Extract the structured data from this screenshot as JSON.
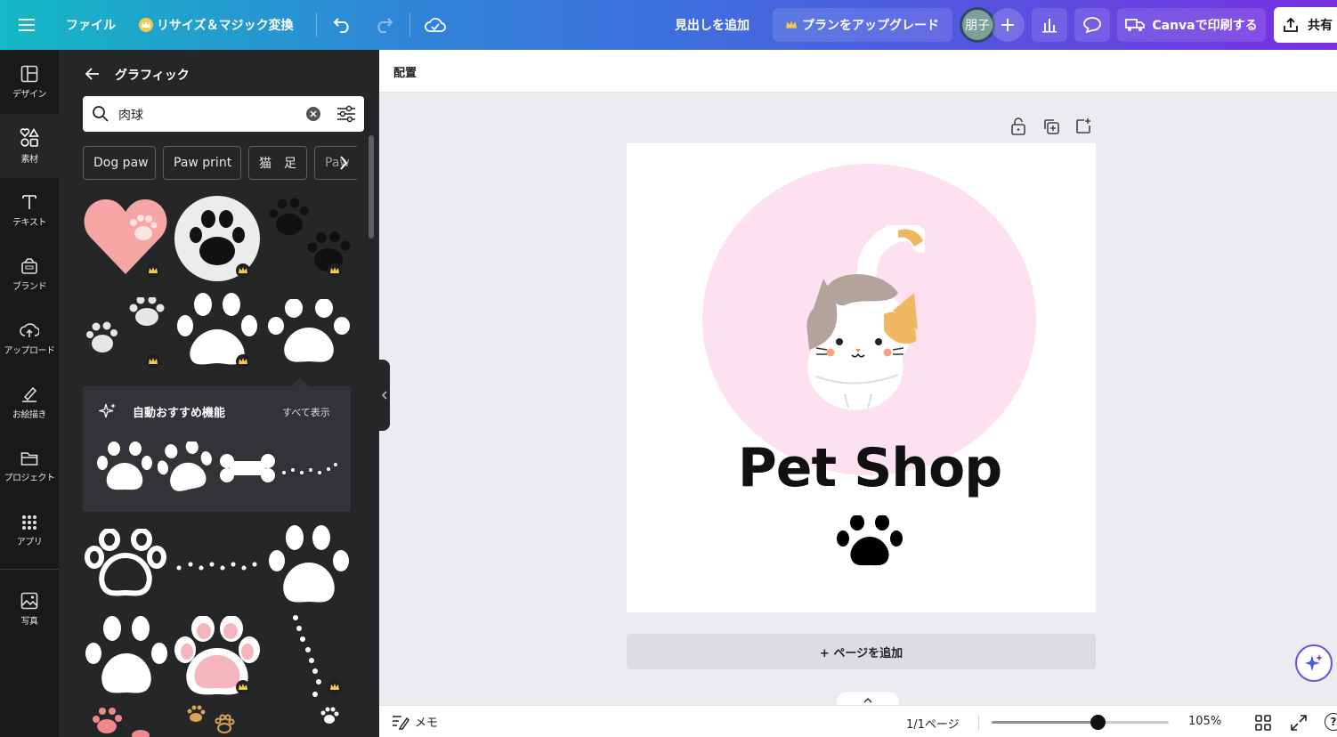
{
  "topbar": {
    "menu_icon": "hamburger-icon",
    "file_label": "ファイル",
    "resize_label": "リサイズ＆マジック変換",
    "add_heading_label": "見出しを追加",
    "upgrade_label": "プランをアップグレード",
    "avatar_text": "朋子",
    "print_label": "Canvaで印刷する",
    "share_label": "共有"
  },
  "rail": {
    "items": [
      {
        "label": "デザイン",
        "icon": "layout-icon"
      },
      {
        "label": "素材",
        "icon": "elements-icon"
      },
      {
        "label": "テキスト",
        "icon": "text-icon"
      },
      {
        "label": "ブランド",
        "icon": "brand-icon"
      },
      {
        "label": "アップロード",
        "icon": "upload-icon"
      },
      {
        "label": "お絵描き",
        "icon": "draw-icon"
      },
      {
        "label": "プロジェクト",
        "icon": "folder-icon"
      },
      {
        "label": "アプリ",
        "icon": "apps-icon"
      },
      {
        "label": "写真",
        "icon": "photo-icon"
      }
    ]
  },
  "panel": {
    "title": "グラフィック",
    "search_value": "肉球",
    "chips": [
      "Dog paw",
      "Paw print",
      "猫　足",
      "Paw"
    ],
    "auto_suggest_title": "自動おすすめ機能",
    "see_all_label": "すべて表示"
  },
  "main": {
    "arrange_label": "配置",
    "canvas_title": "Pet Shop",
    "add_page_label": "+ ページを追加"
  },
  "bottombar": {
    "notes_label": "メモ",
    "page_indicator": "1/1ページ",
    "zoom_label": "105%",
    "zoom_fraction": 0.6
  },
  "colors": {
    "accent_gradient": [
      "#15b8c4",
      "#7b2fe2"
    ],
    "canvas_circle": "#fde1f1",
    "heart": "#f6a5a5"
  }
}
